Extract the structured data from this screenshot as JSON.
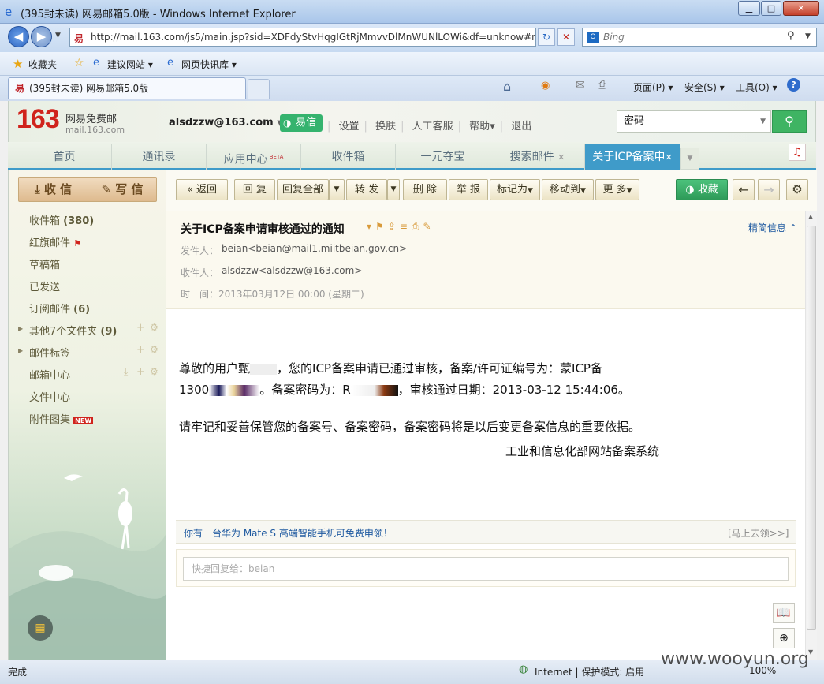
{
  "window": {
    "title": "(395封未读) 网易邮箱5.0版 - Windows Internet Explorer",
    "min": "▁",
    "max": "□",
    "close": "✕"
  },
  "addressbar": {
    "url": "http://mail.163.com/js5/main.jsp?sid=XDFdyStvHqgIGtRjMmvvDlMnWUNlLOWi&df=unknow#n",
    "search_placeholder": "Bing"
  },
  "favbar": {
    "favorites": "收藏夹",
    "item1": "建议网站",
    "item2": "网页快讯库"
  },
  "ietab": {
    "label": "(395封未读) 网易邮箱5.0版"
  },
  "ietools": {
    "page": "页面(P)",
    "safety": "安全(S)",
    "tools": "工具(O)"
  },
  "mail": {
    "logo_num": "163",
    "logo_cn": "网易免费邮",
    "logo_domain": "mail.163.com",
    "account": "alsdzzw@163.com",
    "yixin": "易信",
    "links": [
      "设置",
      "换肤",
      "人工客服",
      "帮助",
      "退出"
    ],
    "search_value": "密码",
    "tabs": [
      {
        "label": "首页"
      },
      {
        "label": "通讯录"
      },
      {
        "label": "应用中心"
      },
      {
        "label": "收件箱"
      },
      {
        "label": "一元夺宝"
      },
      {
        "label": "搜索邮件"
      },
      {
        "label": "关于ICP备案申"
      }
    ],
    "beta": "BETA"
  },
  "sidebar": {
    "receive": "收 信",
    "write": "写 信",
    "items": [
      {
        "label": "收件箱",
        "count": "(380)"
      },
      {
        "label": "红旗邮件",
        "count": ""
      },
      {
        "label": "草稿箱",
        "count": ""
      },
      {
        "label": "已发送",
        "count": ""
      },
      {
        "label": "订阅邮件",
        "count": "(6)"
      },
      {
        "label": "其他7个文件夹",
        "count": "(9)"
      },
      {
        "label": "邮件标签",
        "count": ""
      },
      {
        "label": "邮箱中心",
        "count": ""
      },
      {
        "label": "文件中心",
        "count": ""
      },
      {
        "label": "附件图集",
        "count": ""
      }
    ],
    "new_badge": "NEW"
  },
  "toolbar": {
    "back": "« 返回",
    "reply": "回 复",
    "reply_all": "回复全部",
    "forward": "转 发",
    "delete": "删 除",
    "report": "举 报",
    "mark": "标记为",
    "move": "移动到",
    "more": "更 多",
    "favorite": "收藏"
  },
  "message": {
    "subject": "关于ICP备案申请审核通过的通知",
    "detail_link": "精简信息",
    "from_label": "发件人：",
    "from": "beian<beian@mail1.miitbeian.gov.cn>",
    "to_label": "收件人：",
    "to": "alsdzzw<alsdzzw@163.com>",
    "time_label": "时　间：",
    "time": "2013年03月12日 00:00 (星期二)",
    "body_line1": "尊敬的用户甄",
    "body_line1b": "，您的ICP备案申请已通过审核，备案/许可证编号为：蒙ICP备",
    "body_line2a": "1300",
    "body_line2b": "。备案密码为：R",
    "body_line2c": "，审核通过日期：2013-03-12 15:44:06。",
    "body_para2": "请牢记和妥善保管您的备案号、备案密码，备案密码将是以后变更备案信息的重要依据。",
    "signature": "工业和信息化部网站备案系统"
  },
  "promo": {
    "text": "你有一台华为 Mate S 高端智能手机可免费申领！",
    "link": "[马上去领>>]"
  },
  "quickreply": {
    "placeholder": "快捷回复给：beian"
  },
  "statusbar": {
    "left": "完成",
    "zone": "Internet | 保护模式: 启用",
    "zoom": "100%"
  },
  "watermark": "www.wooyun.org"
}
